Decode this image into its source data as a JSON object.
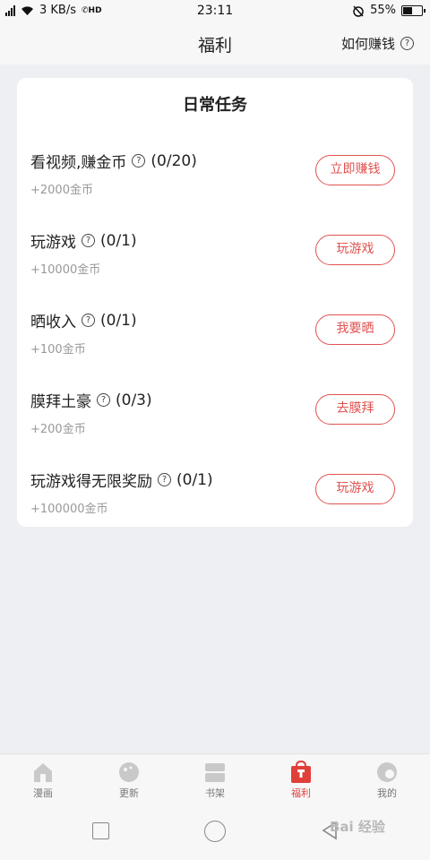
{
  "status_bar": {
    "network_type": "4G",
    "speed": "3 KB/s",
    "hd": "HD",
    "time": "23:11",
    "battery_percent": "55%",
    "battery_level": 0.55
  },
  "header": {
    "title": "福利",
    "help_label": "如何赚钱",
    "help_icon": "question-circle-icon"
  },
  "daily_tasks": {
    "title": "日常任务",
    "items": [
      {
        "name": "看视频,赚金币",
        "progress": "(0/20)",
        "reward": "+2000金币",
        "button": "立即赚钱"
      },
      {
        "name": "玩游戏",
        "progress": "(0/1)",
        "reward": "+10000金币",
        "button": "玩游戏"
      },
      {
        "name": "晒收入",
        "progress": "(0/1)",
        "reward": "+100金币",
        "button": "我要晒"
      },
      {
        "name": "膜拜土豪",
        "progress": "(0/3)",
        "reward": "+200金币",
        "button": "去膜拜"
      },
      {
        "name": "玩游戏得无限奖励",
        "progress": "(0/1)",
        "reward": "+100000金币",
        "button": "玩游戏"
      }
    ]
  },
  "bottom_nav": {
    "items": [
      {
        "label": "漫画",
        "icon": "house-icon"
      },
      {
        "label": "更新",
        "icon": "clock-ball-icon"
      },
      {
        "label": "书架",
        "icon": "bookshelf-icon"
      },
      {
        "label": "福利",
        "icon": "gift-bag-icon"
      },
      {
        "label": "我的",
        "icon": "profile-icon"
      }
    ],
    "active_index": 3
  },
  "watermark": "Bai 经验",
  "colors": {
    "accent": "#e0524f",
    "background": "#eeeff3",
    "card": "#ffffff",
    "muted_text": "#999999"
  }
}
